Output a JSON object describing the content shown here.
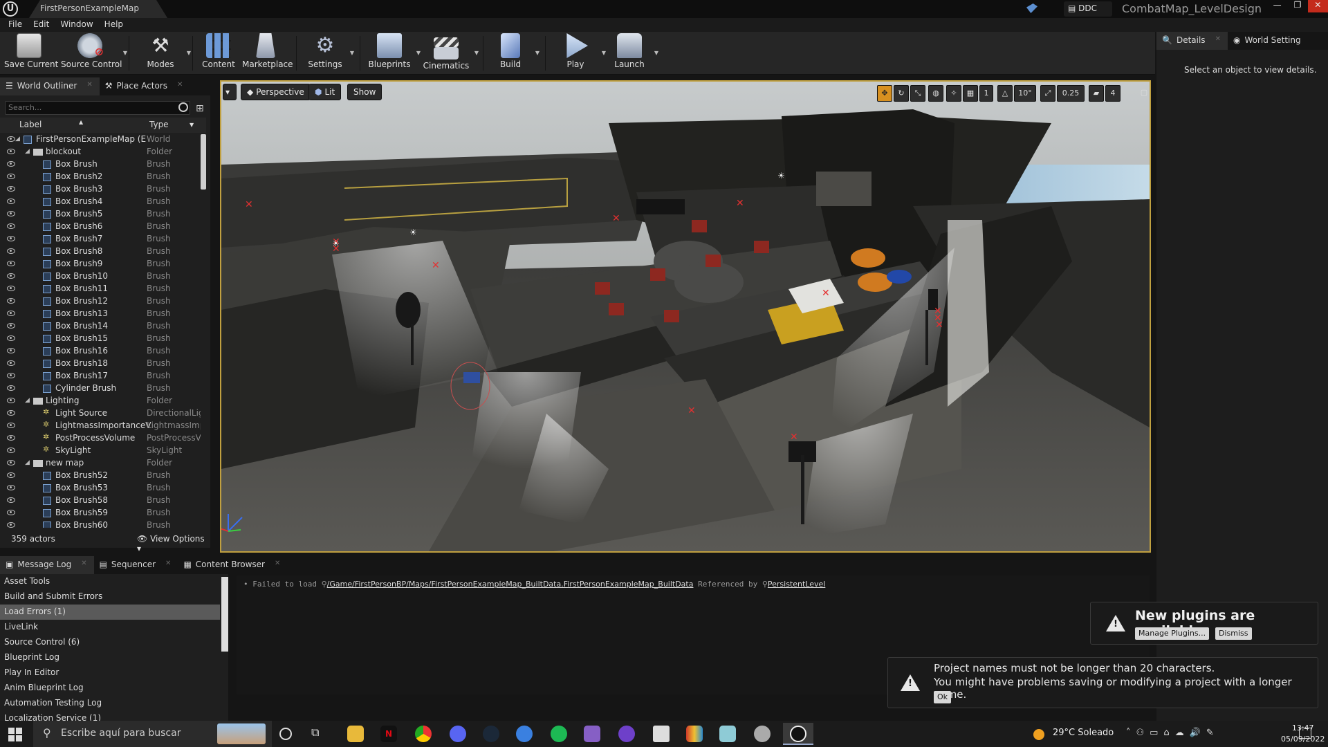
{
  "window": {
    "doc_tab": "FirstPersonExampleMap",
    "ddc_label": "DDC",
    "project_name": "CombatMap_LevelDesign"
  },
  "menu": [
    "File",
    "Edit",
    "Window",
    "Help"
  ],
  "toolbar": {
    "save_current": "Save Current",
    "source_control": "Source Control",
    "modes": "Modes",
    "content": "Content",
    "marketplace": "Marketplace",
    "settings": "Settings",
    "blueprints": "Blueprints",
    "cinematics": "Cinematics",
    "build": "Build",
    "play": "Play",
    "launch": "Launch"
  },
  "outliner": {
    "tab_world_outliner": "World Outliner",
    "tab_place_actors": "Place Actors",
    "search_placeholder": "Search...",
    "col_label": "Label",
    "col_type": "Type",
    "rows": [
      {
        "name": "FirstPersonExampleMap (E",
        "type": "World"
      },
      {
        "name": "blockout",
        "type": "Folder"
      },
      {
        "name": "Box Brush",
        "type": "Brush"
      },
      {
        "name": "Box Brush2",
        "type": "Brush"
      },
      {
        "name": "Box Brush3",
        "type": "Brush"
      },
      {
        "name": "Box Brush4",
        "type": "Brush"
      },
      {
        "name": "Box Brush5",
        "type": "Brush"
      },
      {
        "name": "Box Brush6",
        "type": "Brush"
      },
      {
        "name": "Box Brush7",
        "type": "Brush"
      },
      {
        "name": "Box Brush8",
        "type": "Brush"
      },
      {
        "name": "Box Brush9",
        "type": "Brush"
      },
      {
        "name": "Box Brush10",
        "type": "Brush"
      },
      {
        "name": "Box Brush11",
        "type": "Brush"
      },
      {
        "name": "Box Brush12",
        "type": "Brush"
      },
      {
        "name": "Box Brush13",
        "type": "Brush"
      },
      {
        "name": "Box Brush14",
        "type": "Brush"
      },
      {
        "name": "Box Brush15",
        "type": "Brush"
      },
      {
        "name": "Box Brush16",
        "type": "Brush"
      },
      {
        "name": "Box Brush18",
        "type": "Brush"
      },
      {
        "name": "Box Brush17",
        "type": "Brush"
      },
      {
        "name": "Cylinder Brush",
        "type": "Brush"
      },
      {
        "name": "Lighting",
        "type": "Folder"
      },
      {
        "name": "Light Source",
        "type": "DirectionalLig"
      },
      {
        "name": "LightmassImportanceV",
        "type": "LightmassImp"
      },
      {
        "name": "PostProcessVolume",
        "type": "PostProcessV"
      },
      {
        "name": "SkyLight",
        "type": "SkyLight"
      },
      {
        "name": "new map",
        "type": "Folder"
      },
      {
        "name": "Box Brush52",
        "type": "Brush"
      },
      {
        "name": "Box Brush53",
        "type": "Brush"
      },
      {
        "name": "Box Brush58",
        "type": "Brush"
      },
      {
        "name": "Box Brush59",
        "type": "Brush"
      },
      {
        "name": "Box Brush60",
        "type": "Brush"
      }
    ],
    "actor_count": "359 actors",
    "view_options": "View Options"
  },
  "viewport": {
    "perspective": "Perspective",
    "lit": "Lit",
    "show": "Show",
    "grid_value": "1",
    "rotation_snap": "10°",
    "scale_snap": "0.25",
    "camera_speed": "4"
  },
  "details": {
    "tab_details": "Details",
    "tab_world_settings": "World Setting",
    "empty_message": "Select an object to view details."
  },
  "bottom": {
    "tab_message_log": "Message Log",
    "tab_sequencer": "Sequencer",
    "tab_content_browser": "Content Browser",
    "categories": [
      "Asset Tools",
      "Build and Submit Errors",
      "Load Errors (1)",
      "LiveLink",
      "Source Control (6)",
      "Blueprint Log",
      "Play In Editor",
      "Anim Blueprint Log",
      "Automation Testing Log",
      "Localization Service (1)"
    ],
    "log": {
      "prefix": "Failed to load",
      "path": "/Game/FirstPersonBP/Maps/FirstPersonExampleMap_BuiltData.FirstPersonExampleMap_BuiltData",
      "mid": "Referenced by",
      "ref": "PersistentLevel"
    }
  },
  "notifications": {
    "plugins_title": "New plugins are available",
    "manage_plugins": "Manage Plugins...",
    "dismiss": "Dismiss",
    "name_line1": "Project names must not be longer than 20 characters.",
    "name_line2": "You might have problems saving or modifying a project with a longer name.",
    "ok": "Ok"
  },
  "taskbar": {
    "search_placeholder": "Escribe aquí para buscar",
    "weather": "29°C  Soleado",
    "time": "13:47",
    "date": "05/09/2022"
  }
}
